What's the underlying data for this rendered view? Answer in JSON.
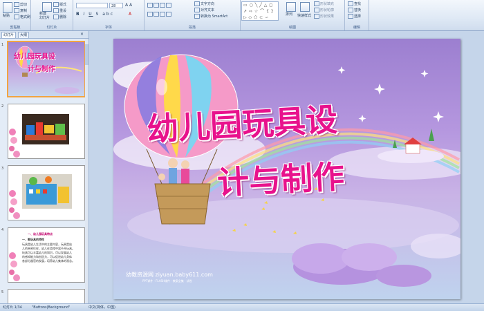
{
  "ribbon": {
    "clipboard": {
      "paste": "粘贴",
      "cut": "剪切",
      "copy": "复制",
      "format_painter": "格式刷",
      "label": "剪贴板"
    },
    "slides": {
      "new_slide": "新建\n幻灯片",
      "layout": "版式",
      "reset": "重设",
      "delete": "删除",
      "label": "幻灯片"
    },
    "font": {
      "size": "28",
      "label": "字体"
    },
    "paragraph": {
      "text_direction": "文字方向",
      "align_text": "对齐文本",
      "smartart": "转换为 SmartArt",
      "label": "段落"
    },
    "drawing": {
      "arrange": "排列",
      "quick_styles": "快速样式",
      "shape_fill": "形状填充",
      "shape_outline": "形状轮廓",
      "shape_effects": "形状效果",
      "label": "绘图"
    },
    "editing": {
      "find": "查找",
      "replace": "替换",
      "select": "选择",
      "label": "编辑"
    }
  },
  "panel": {
    "tabs": [
      "幻灯片",
      "大纲"
    ],
    "slide_numbers": [
      "1",
      "2",
      "3",
      "4",
      "5"
    ],
    "thumb1_title": [
      "幼儿园玩具设",
      "计与制作"
    ],
    "thumb4_lines": [
      "一、幼儿园玩具特点",
      "一、教玩具的特性",
      "玩具是幼儿生活中的主要内容，玩具是幼",
      "儿的亲密伙伴，幼儿在游戏中离不开玩具。",
      "玩具可以丰富幼儿的知识，可以发展幼儿",
      "的感知能力和创造力，可以促进幼儿身体",
      "各部分器官的发展，培养幼儿集体的观念。"
    ]
  },
  "slide": {
    "title_line1": "幼儿园玩具设",
    "title_line2": "计与制作",
    "footer": "幼教资源网 ziyuan.baby611.com",
    "footer_sub": "PPT课件 · FLASH课件 · 教案全集 · 试卷"
  },
  "statusbar": {
    "slide_info": "幻灯片 1/34",
    "theme": "\"Buttons|Background\"",
    "language": "中文(简体，中国)"
  },
  "colors": {
    "title": "#e8128c",
    "ribbon_bg": "#dfe9f5",
    "selected_thumb": "#f2a441"
  }
}
